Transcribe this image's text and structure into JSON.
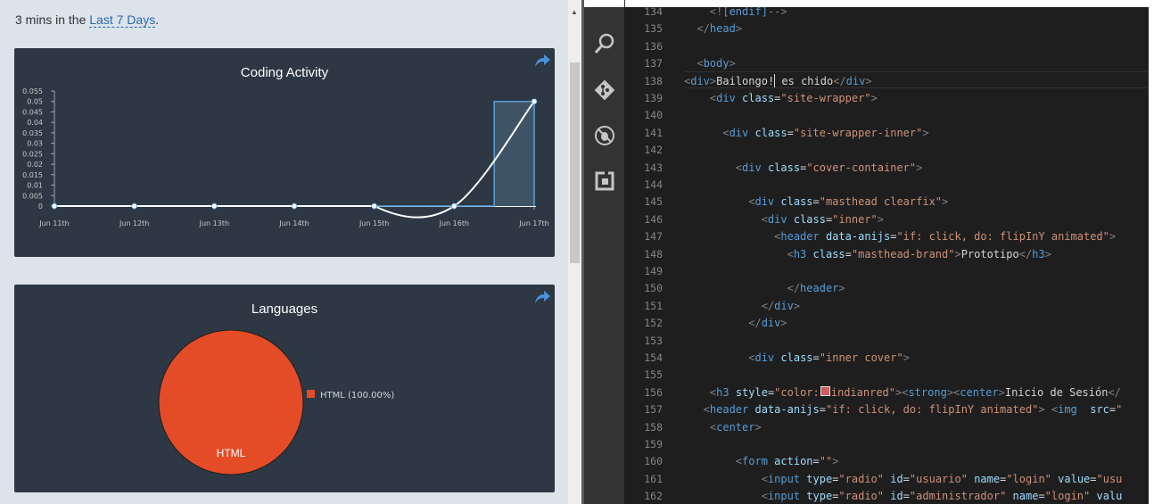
{
  "summary": {
    "prefix": "3 mins in the",
    "link": "Last 7 Days",
    "suffix": "."
  },
  "charts": {
    "activity_title": "Coding Activity",
    "languages_title": "Languages"
  },
  "chart_data": [
    {
      "type": "line",
      "title": "Coding Activity",
      "x": [
        "Jun 11th",
        "Jun 12th",
        "Jun 13th",
        "Jun 14th",
        "Jun 15th",
        "Jun 16th",
        "Jun 17th"
      ],
      "y_ticks": [
        "0",
        "0.005",
        "0.01",
        "0.015",
        "0.02",
        "0.025",
        "0.03",
        "0.035",
        "0.04",
        "0.045",
        "0.05",
        "0.055"
      ],
      "ylim": [
        0,
        0.055
      ],
      "series": [
        {
          "values": [
            0,
            0,
            0,
            0,
            0,
            0,
            0.05
          ]
        }
      ],
      "colors": {
        "line": "#ffffff",
        "bars": "#3e5366",
        "bar_outline": "#5aa0d8"
      }
    },
    {
      "type": "pie",
      "title": "Languages",
      "slices": [
        {
          "label": "HTML",
          "value": 100.0
        }
      ],
      "legend": [
        "HTML (100.00%)"
      ],
      "legend_position": "right",
      "colors": {
        "HTML": "#e34c26"
      }
    }
  ],
  "activity_bar": {
    "icons": [
      "search-icon",
      "git-icon",
      "debug-icon",
      "extensions-icon"
    ]
  },
  "editor": {
    "lines": [
      {
        "n": "134",
        "segs": [
          {
            "c": "p",
            "t": "    <!"
          },
          {
            "c": "t",
            "t": "[endif]"
          },
          {
            "c": "p",
            "t": "-->"
          }
        ]
      },
      {
        "n": "135",
        "segs": [
          {
            "c": "p",
            "t": "  </"
          },
          {
            "c": "t",
            "t": "head"
          },
          {
            "c": "p",
            "t": ">"
          }
        ]
      },
      {
        "n": "136",
        "segs": []
      },
      {
        "n": "137",
        "segs": [
          {
            "c": "p",
            "t": "  <"
          },
          {
            "c": "t",
            "t": "body"
          },
          {
            "c": "p",
            "t": ">"
          }
        ]
      },
      {
        "n": "138",
        "segs": [
          {
            "c": "p",
            "t": "<"
          },
          {
            "c": "t",
            "t": "div"
          },
          {
            "c": "p",
            "t": ">"
          },
          {
            "c": "x",
            "t": "Bailongo!"
          },
          {
            "c": "caret",
            "t": ""
          },
          {
            "c": "x",
            "t": " es chido"
          },
          {
            "c": "p",
            "t": "</"
          },
          {
            "c": "t",
            "t": "div"
          },
          {
            "c": "p",
            "t": ">"
          }
        ]
      },
      {
        "n": "139",
        "segs": [
          {
            "c": "p",
            "t": "    <"
          },
          {
            "c": "t",
            "t": "div"
          },
          {
            "c": "x",
            "t": " "
          },
          {
            "c": "a",
            "t": "class"
          },
          {
            "c": "x",
            "t": "="
          },
          {
            "c": "s",
            "t": "\"site-wrapper\""
          },
          {
            "c": "p",
            "t": ">"
          }
        ]
      },
      {
        "n": "140",
        "segs": []
      },
      {
        "n": "141",
        "segs": [
          {
            "c": "p",
            "t": "      <"
          },
          {
            "c": "t",
            "t": "div"
          },
          {
            "c": "x",
            "t": " "
          },
          {
            "c": "a",
            "t": "class"
          },
          {
            "c": "x",
            "t": "="
          },
          {
            "c": "s",
            "t": "\"site-wrapper-inner\""
          },
          {
            "c": "p",
            "t": ">"
          }
        ]
      },
      {
        "n": "142",
        "segs": []
      },
      {
        "n": "143",
        "segs": [
          {
            "c": "p",
            "t": "        <"
          },
          {
            "c": "t",
            "t": "div"
          },
          {
            "c": "x",
            "t": " "
          },
          {
            "c": "a",
            "t": "class"
          },
          {
            "c": "x",
            "t": "="
          },
          {
            "c": "s",
            "t": "\"cover-container\""
          },
          {
            "c": "p",
            "t": ">"
          }
        ]
      },
      {
        "n": "144",
        "segs": []
      },
      {
        "n": "145",
        "segs": [
          {
            "c": "p",
            "t": "          <"
          },
          {
            "c": "t",
            "t": "div"
          },
          {
            "c": "x",
            "t": " "
          },
          {
            "c": "a",
            "t": "class"
          },
          {
            "c": "x",
            "t": "="
          },
          {
            "c": "s",
            "t": "\"masthead clearfix\""
          },
          {
            "c": "p",
            "t": ">"
          }
        ]
      },
      {
        "n": "146",
        "segs": [
          {
            "c": "p",
            "t": "            <"
          },
          {
            "c": "t",
            "t": "div"
          },
          {
            "c": "x",
            "t": " "
          },
          {
            "c": "a",
            "t": "class"
          },
          {
            "c": "x",
            "t": "="
          },
          {
            "c": "s",
            "t": "\"inner\""
          },
          {
            "c": "p",
            "t": ">"
          }
        ]
      },
      {
        "n": "147",
        "segs": [
          {
            "c": "p",
            "t": "              <"
          },
          {
            "c": "t",
            "t": "header"
          },
          {
            "c": "x",
            "t": " "
          },
          {
            "c": "a",
            "t": "data-anijs"
          },
          {
            "c": "x",
            "t": "="
          },
          {
            "c": "s",
            "t": "\"if: click, do: flipInY animated\""
          },
          {
            "c": "p",
            "t": ">"
          }
        ]
      },
      {
        "n": "148",
        "segs": [
          {
            "c": "p",
            "t": "                <"
          },
          {
            "c": "t",
            "t": "h3"
          },
          {
            "c": "x",
            "t": " "
          },
          {
            "c": "a",
            "t": "class"
          },
          {
            "c": "x",
            "t": "="
          },
          {
            "c": "s",
            "t": "\"masthead-brand\""
          },
          {
            "c": "p",
            "t": ">"
          },
          {
            "c": "x",
            "t": "Prototipo"
          },
          {
            "c": "p",
            "t": "</"
          },
          {
            "c": "t",
            "t": "h3"
          },
          {
            "c": "p",
            "t": ">"
          }
        ]
      },
      {
        "n": "149",
        "segs": []
      },
      {
        "n": "150",
        "segs": [
          {
            "c": "p",
            "t": "                </"
          },
          {
            "c": "t",
            "t": "header"
          },
          {
            "c": "p",
            "t": ">"
          }
        ]
      },
      {
        "n": "151",
        "segs": [
          {
            "c": "p",
            "t": "            </"
          },
          {
            "c": "t",
            "t": "div"
          },
          {
            "c": "p",
            "t": ">"
          }
        ]
      },
      {
        "n": "152",
        "segs": [
          {
            "c": "p",
            "t": "          </"
          },
          {
            "c": "t",
            "t": "div"
          },
          {
            "c": "p",
            "t": ">"
          }
        ]
      },
      {
        "n": "153",
        "segs": []
      },
      {
        "n": "154",
        "segs": [
          {
            "c": "p",
            "t": "          <"
          },
          {
            "c": "t",
            "t": "div"
          },
          {
            "c": "x",
            "t": " "
          },
          {
            "c": "a",
            "t": "class"
          },
          {
            "c": "x",
            "t": "="
          },
          {
            "c": "s",
            "t": "\"inner cover\""
          },
          {
            "c": "p",
            "t": ">"
          }
        ]
      },
      {
        "n": "155",
        "segs": []
      },
      {
        "n": "156",
        "segs": [
          {
            "c": "p",
            "t": "    <"
          },
          {
            "c": "t",
            "t": "h3"
          },
          {
            "c": "x",
            "t": " "
          },
          {
            "c": "a",
            "t": "style"
          },
          {
            "c": "x",
            "t": "="
          },
          {
            "c": "s",
            "t": "\"color:"
          },
          {
            "c": "swatch",
            "t": ""
          },
          {
            "c": "s",
            "t": "indianred\""
          },
          {
            "c": "p",
            "t": "><"
          },
          {
            "c": "t",
            "t": "strong"
          },
          {
            "c": "p",
            "t": "><"
          },
          {
            "c": "t",
            "t": "center"
          },
          {
            "c": "p",
            "t": ">"
          },
          {
            "c": "x",
            "t": "Inicio de Sesión"
          },
          {
            "c": "p",
            "t": "</"
          }
        ]
      },
      {
        "n": "157",
        "segs": [
          {
            "c": "p",
            "t": "   <"
          },
          {
            "c": "t",
            "t": "header"
          },
          {
            "c": "x",
            "t": " "
          },
          {
            "c": "a",
            "t": "data-anijs"
          },
          {
            "c": "x",
            "t": "="
          },
          {
            "c": "s",
            "t": "\"if: click, do: flipInY animated\""
          },
          {
            "c": "p",
            "t": "> <"
          },
          {
            "c": "t",
            "t": "img"
          },
          {
            "c": "x",
            "t": "  "
          },
          {
            "c": "a",
            "t": "src"
          },
          {
            "c": "x",
            "t": "="
          },
          {
            "c": "s",
            "t": "\""
          }
        ]
      },
      {
        "n": "158",
        "segs": [
          {
            "c": "p",
            "t": "    <"
          },
          {
            "c": "t",
            "t": "center"
          },
          {
            "c": "p",
            "t": ">"
          }
        ]
      },
      {
        "n": "159",
        "segs": []
      },
      {
        "n": "160",
        "segs": [
          {
            "c": "p",
            "t": "        <"
          },
          {
            "c": "t",
            "t": "form"
          },
          {
            "c": "x",
            "t": " "
          },
          {
            "c": "a",
            "t": "action"
          },
          {
            "c": "x",
            "t": "="
          },
          {
            "c": "s",
            "t": "\"\""
          },
          {
            "c": "p",
            "t": ">"
          }
        ]
      },
      {
        "n": "161",
        "segs": [
          {
            "c": "p",
            "t": "            <"
          },
          {
            "c": "t",
            "t": "input"
          },
          {
            "c": "x",
            "t": " "
          },
          {
            "c": "a",
            "t": "type"
          },
          {
            "c": "x",
            "t": "="
          },
          {
            "c": "s",
            "t": "\"radio\""
          },
          {
            "c": "x",
            "t": " "
          },
          {
            "c": "a",
            "t": "id"
          },
          {
            "c": "x",
            "t": "="
          },
          {
            "c": "s",
            "t": "\"usuario\""
          },
          {
            "c": "x",
            "t": " "
          },
          {
            "c": "a",
            "t": "name"
          },
          {
            "c": "x",
            "t": "="
          },
          {
            "c": "s",
            "t": "\"login\""
          },
          {
            "c": "x",
            "t": " "
          },
          {
            "c": "a",
            "t": "value"
          },
          {
            "c": "x",
            "t": "="
          },
          {
            "c": "s",
            "t": "\"usu"
          }
        ]
      },
      {
        "n": "162",
        "segs": [
          {
            "c": "p",
            "t": "            <"
          },
          {
            "c": "t",
            "t": "input"
          },
          {
            "c": "x",
            "t": " "
          },
          {
            "c": "a",
            "t": "type"
          },
          {
            "c": "x",
            "t": "="
          },
          {
            "c": "s",
            "t": "\"radio\""
          },
          {
            "c": "x",
            "t": " "
          },
          {
            "c": "a",
            "t": "id"
          },
          {
            "c": "x",
            "t": "="
          },
          {
            "c": "s",
            "t": "\"administrador\""
          },
          {
            "c": "x",
            "t": " "
          },
          {
            "c": "a",
            "t": "name"
          },
          {
            "c": "x",
            "t": "="
          },
          {
            "c": "s",
            "t": "\"login\""
          },
          {
            "c": "x",
            "t": " "
          },
          {
            "c": "a",
            "t": "valu"
          }
        ]
      }
    ]
  }
}
